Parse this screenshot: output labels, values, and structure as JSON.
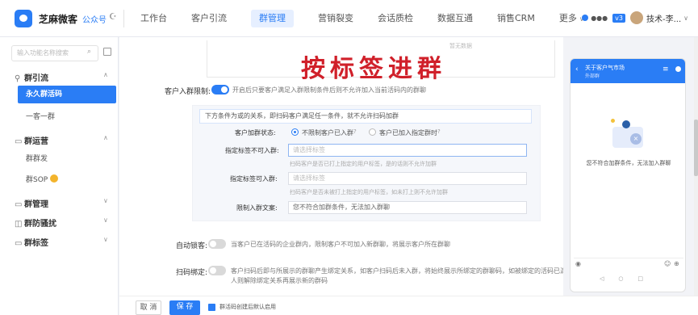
{
  "topbar": {
    "brand": "芝麻微客",
    "brand_tag": "公众号",
    "nav": [
      {
        "label": "工作台"
      },
      {
        "label": "客户引流"
      },
      {
        "label": "群管理",
        "active": true
      },
      {
        "label": "营销裂变"
      },
      {
        "label": "会话质检"
      },
      {
        "label": "数据互通"
      },
      {
        "label": "销售CRM"
      },
      {
        "label": "更多"
      }
    ],
    "badge": "v3",
    "user": "技术-李..."
  },
  "sidebar": {
    "search_placeholder": "输入功能名称搜索",
    "groups": [
      {
        "label": "群引流",
        "subs": [
          "永久群活码",
          "一客一群"
        ]
      },
      {
        "label": "群运营",
        "subs": [
          "群群发",
          "群SOP"
        ]
      },
      {
        "label": "群管理"
      },
      {
        "label": "群防骚扰"
      },
      {
        "label": "群标签"
      }
    ]
  },
  "main": {
    "qr_note": "暂无数据",
    "title": "按标签进群",
    "limit": {
      "label": "客户入群限制:",
      "desc": "开启后只要客户满足入群限制条件后则不允许加入当前活码内的群聊"
    },
    "panel": {
      "title": "下方条件为或的关系，即扫码客户满足任一条件，就不允许扫码加群",
      "status_label": "客户加群状态:",
      "status_opt1": "不限制客户已入群",
      "status_opt2": "客户已加入指定群时",
      "tag_no_label": "指定标签不可入群:",
      "tag_no_placeholder": "请选择标签",
      "tag_no_hint": "扫码客户是否已打上指定的用户标签，是的话则不允许加群",
      "tag_yes_label": "指定标签可入群:",
      "tag_yes_placeholder": "请选择标签",
      "tag_yes_hint": "扫码客户是否未被打上指定的用户标签，如未打上则不允许加群",
      "msg_label": "限制入群文案:",
      "msg_value": "您不符合加群条件，无法加入群聊"
    },
    "auto_lock": {
      "label": "自动锁客:",
      "desc": "当客户已在活码的企业群内，限制客户不可加入新群聊，将展示客户所在群聊"
    },
    "scan_bind": {
      "label": "扫码绑定:",
      "desc1": "客户扫码后即与所展示的群聊产生绑定关系，如客户扫码后未入群，将始终展示所绑定的群聊码，如被绑定的活码已满",
      "desc2": "人则解除绑定关系再展示新的群码"
    }
  },
  "footer": {
    "cancel": "取 消",
    "save": "保 存",
    "checkbox_label": "群活码创建后默认启用"
  },
  "preview": {
    "phone_title": "关于客户气市场",
    "phone_sub": "外部群",
    "message": "您不符合加群条件，无法加入群聊"
  },
  "colors": {
    "accent": "#2a7df5",
    "title_red": "#d0202a"
  }
}
